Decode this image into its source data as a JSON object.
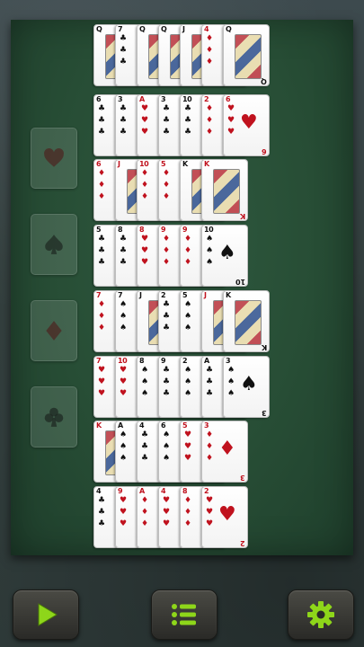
{
  "colors": {
    "felt": "#274d35",
    "button_green": "#8ed61a",
    "red_suit": "#c0121e",
    "black_suit": "#111111"
  },
  "foundations": [
    {
      "suit": "heart",
      "icon": "heart-icon"
    },
    {
      "suit": "spade",
      "icon": "spade-icon"
    },
    {
      "suit": "diamond",
      "icon": "diamond-icon"
    },
    {
      "suit": "club",
      "icon": "club-icon"
    }
  ],
  "tableau": [
    [
      {
        "rank": "Q",
        "suit": "club"
      },
      {
        "rank": "7",
        "suit": "club"
      },
      {
        "rank": "Q",
        "suit": "club"
      },
      {
        "rank": "Q",
        "suit": "club"
      },
      {
        "rank": "J",
        "suit": "spade"
      },
      {
        "rank": "4",
        "suit": "diamond"
      },
      {
        "rank": "Q",
        "suit": "spade"
      }
    ],
    [
      {
        "rank": "6",
        "suit": "club"
      },
      {
        "rank": "3",
        "suit": "club"
      },
      {
        "rank": "A",
        "suit": "heart"
      },
      {
        "rank": "3",
        "suit": "club"
      },
      {
        "rank": "10",
        "suit": "club"
      },
      {
        "rank": "2",
        "suit": "diamond"
      },
      {
        "rank": "6",
        "suit": "heart"
      }
    ],
    [
      {
        "rank": "6",
        "suit": "diamond"
      },
      {
        "rank": "J",
        "suit": "diamond"
      },
      {
        "rank": "10",
        "suit": "diamond"
      },
      {
        "rank": "5",
        "suit": "diamond"
      },
      {
        "rank": "K",
        "suit": "spade"
      },
      {
        "rank": "K",
        "suit": "heart"
      }
    ],
    [
      {
        "rank": "5",
        "suit": "club"
      },
      {
        "rank": "8",
        "suit": "club"
      },
      {
        "rank": "8",
        "suit": "heart"
      },
      {
        "rank": "9",
        "suit": "diamond"
      },
      {
        "rank": "9",
        "suit": "diamond"
      },
      {
        "rank": "10",
        "suit": "spade"
      }
    ],
    [
      {
        "rank": "7",
        "suit": "diamond"
      },
      {
        "rank": "7",
        "suit": "spade"
      },
      {
        "rank": "J",
        "suit": "club"
      },
      {
        "rank": "2",
        "suit": "club"
      },
      {
        "rank": "5",
        "suit": "spade"
      },
      {
        "rank": "J",
        "suit": "heart"
      },
      {
        "rank": "K",
        "suit": "club"
      }
    ],
    [
      {
        "rank": "7",
        "suit": "heart"
      },
      {
        "rank": "10",
        "suit": "heart"
      },
      {
        "rank": "8",
        "suit": "spade"
      },
      {
        "rank": "9",
        "suit": "club"
      },
      {
        "rank": "2",
        "suit": "spade"
      },
      {
        "rank": "A",
        "suit": "club"
      },
      {
        "rank": "3",
        "suit": "spade"
      }
    ],
    [
      {
        "rank": "K",
        "suit": "diamond"
      },
      {
        "rank": "A",
        "suit": "spade"
      },
      {
        "rank": "4",
        "suit": "club"
      },
      {
        "rank": "6",
        "suit": "spade"
      },
      {
        "rank": "5",
        "suit": "heart"
      },
      {
        "rank": "3",
        "suit": "diamond"
      }
    ],
    [
      {
        "rank": "4",
        "suit": "club"
      },
      {
        "rank": "9",
        "suit": "heart"
      },
      {
        "rank": "A",
        "suit": "diamond"
      },
      {
        "rank": "4",
        "suit": "heart"
      },
      {
        "rank": "8",
        "suit": "diamond"
      },
      {
        "rank": "2",
        "suit": "heart"
      }
    ]
  ],
  "buttons": [
    {
      "name": "play-button",
      "icon": "play-icon"
    },
    {
      "name": "menu-button",
      "icon": "list-icon"
    },
    {
      "name": "settings-button",
      "icon": "gear-icon"
    }
  ]
}
